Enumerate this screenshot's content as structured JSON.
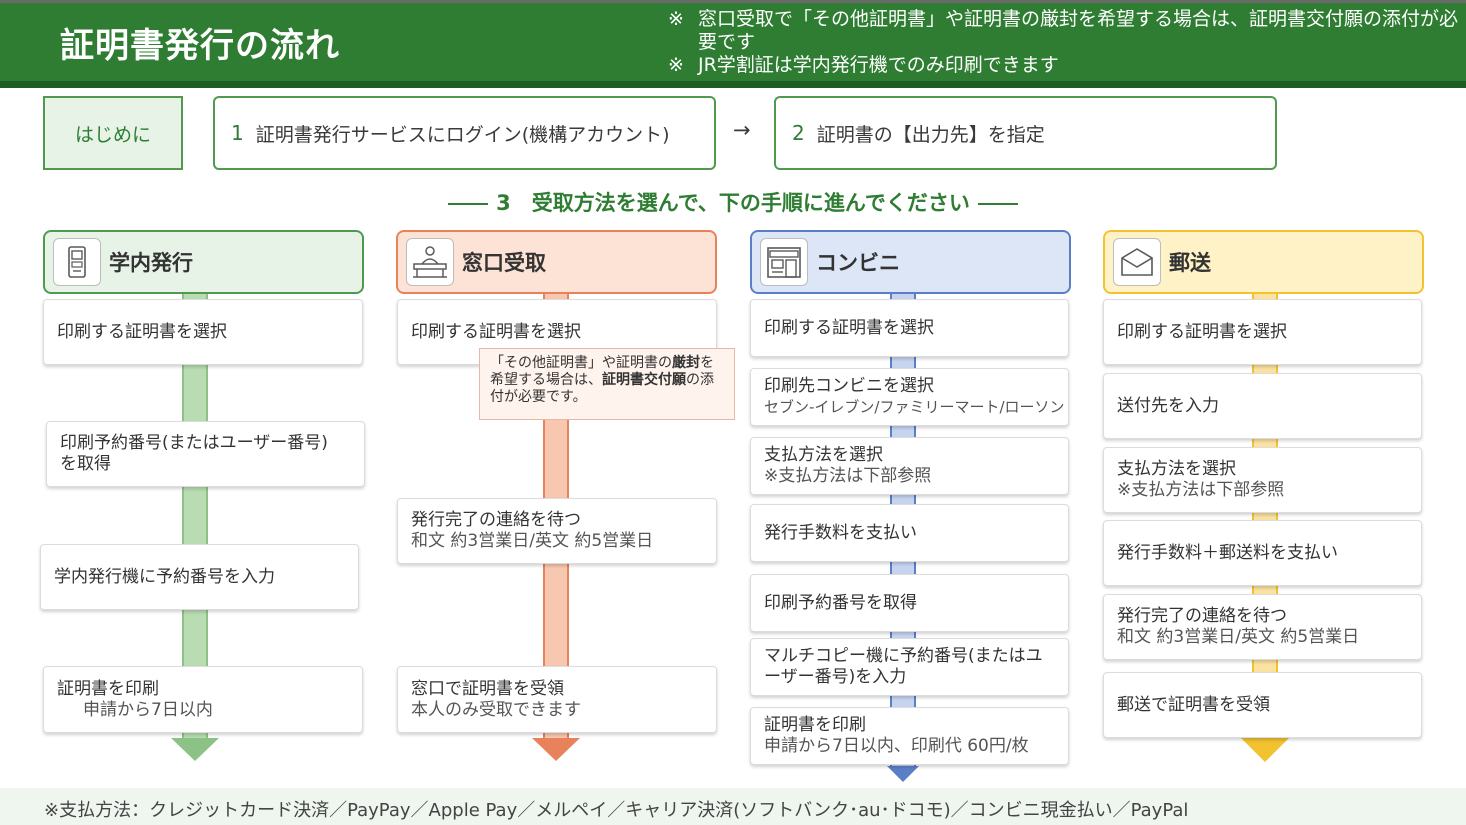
{
  "header": {
    "title": "証明書発行の流れ",
    "notes": [
      {
        "mark": "※",
        "text": "窓口受取で「その他証明書」や証明書の厳封を希望する場合は、証明書交付願の添付が必要です"
      },
      {
        "mark": "※",
        "text": "JR学割証は学内発行機でのみ印刷できます"
      }
    ]
  },
  "intro": {
    "label": "はじめに",
    "step1": {
      "num": "1",
      "text": "証明書発行サービスにログイン(機構アカウント)"
    },
    "arrow": "→",
    "step2": {
      "num": "2",
      "text": "証明書の【出力先】を指定"
    }
  },
  "subtitle": "3　受取方法を選んで、下の手順に進んでください",
  "columns": {
    "campus": {
      "title": "学内発行",
      "steps": [
        {
          "line1": "印刷する証明書を選択"
        },
        {
          "line1": "印刷予約番号(またはユーザー番号)",
          "line2": "を取得"
        },
        {
          "line1": "学内発行機に予約番号を入力"
        },
        {
          "line1": "証明書を印刷",
          "line2": "申請から7日以内"
        }
      ]
    },
    "counter": {
      "title": "窓口受取",
      "steps": [
        {
          "line1": "印刷する証明書を選択"
        },
        {
          "line1": "発行完了の連絡を待つ",
          "line2": "和文 約3営業日/英文 約5営業日"
        },
        {
          "line1": "窓口で証明書を受領",
          "line2": "本人のみ受取できます"
        }
      ],
      "callout": {
        "p1": "「その他証明書」や証明書の",
        "b1": "厳封",
        "p2": "を希望する場合は、",
        "b2": "証明書交付願",
        "p3": "の添付が必要です。"
      }
    },
    "convenience": {
      "title": "コンビニ",
      "steps": [
        {
          "line1": "印刷する証明書を選択"
        },
        {
          "line1": "印刷先コンビニを選択",
          "line2": "セブン-イレブン/ファミリーマート/ローソン"
        },
        {
          "line1": "支払方法を選択",
          "line2": "※支払方法は下部参照"
        },
        {
          "line1": "発行手数料を支払い"
        },
        {
          "line1": "印刷予約番号を取得"
        },
        {
          "line1": "マルチコピー機に予約番号(またはユ",
          "line2": "ーザー番号)を入力"
        },
        {
          "line1": "証明書を印刷",
          "line2": "申請から7日以内、印刷代 60円/枚"
        }
      ]
    },
    "mail": {
      "title": "郵送",
      "steps": [
        {
          "line1": "印刷する証明書を選択"
        },
        {
          "line1": "送付先を入力"
        },
        {
          "line1": "支払方法を選択",
          "line2": "※支払方法は下部参照"
        },
        {
          "line1": "発行手数料＋郵送料を支払い"
        },
        {
          "line1": "発行完了の連絡を待つ",
          "line2": "和文 約3営業日/英文 約5営業日"
        },
        {
          "line1": "郵送で証明書を受領"
        }
      ]
    }
  },
  "footer": "※支払方法：クレジットカード決済／PayPay／Apple Pay／メルペイ／キャリア決済(ソフトバンク･au･ドコモ)／コンビニ現金払い／PayPal",
  "colors": {
    "header_green": "#2e7d32",
    "green": "#4f9a4f",
    "orange": "#e8825a",
    "blue": "#5b7fc7",
    "yellow": "#f2c230"
  },
  "icons": {
    "campus": "kiosk-terminal-icon",
    "counter": "counter-desk-icon",
    "convenience": "store-front-icon",
    "mail": "envelope-icon"
  }
}
